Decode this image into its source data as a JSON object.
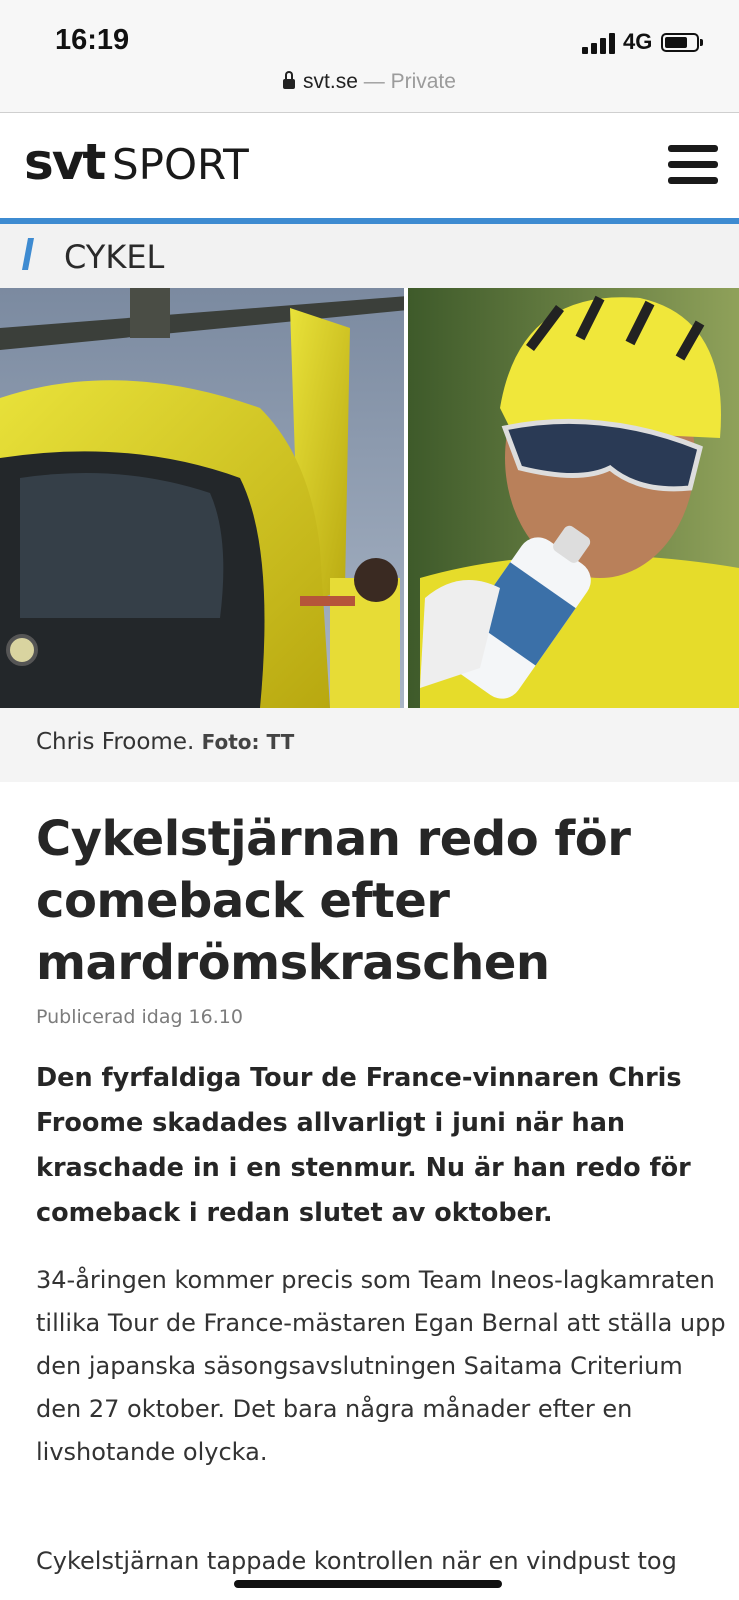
{
  "status_bar": {
    "time": "16:19",
    "network": "4G",
    "url_domain": "svt.se",
    "url_suffix": " — Private"
  },
  "header": {
    "logo_brand": "svt",
    "logo_section": "SPORT",
    "menu_icon": "hamburger-menu-icon",
    "accent_color": "#3e8bd1"
  },
  "section": {
    "label": "CYKEL"
  },
  "hero": {
    "caption_name": "Chris Froome.",
    "caption_credit": "Foto: TT"
  },
  "article": {
    "headline": "Cykelstjärnan redo för comeback efter mardrömskraschen",
    "published": "Publicerad idag 16.10",
    "lead": "Den fyrfaldiga Tour de France-vinnaren Chris Froome skadades allvarligt i juni när han kraschade in i en stenmur. Nu är han redo för comeback i redan slutet av oktober.",
    "paragraphs": [
      "34-åringen kommer precis som Team Ineos-lagkamraten tillika Tour de France-mästaren Egan Bernal att ställa upp den japanska säsongsavslutningen Saitama Criterium den 27 oktober. Det bara några månader efter en livshotande olycka.",
      "Cykelstjärnan tappade kontrollen när en vindpust tog"
    ]
  }
}
